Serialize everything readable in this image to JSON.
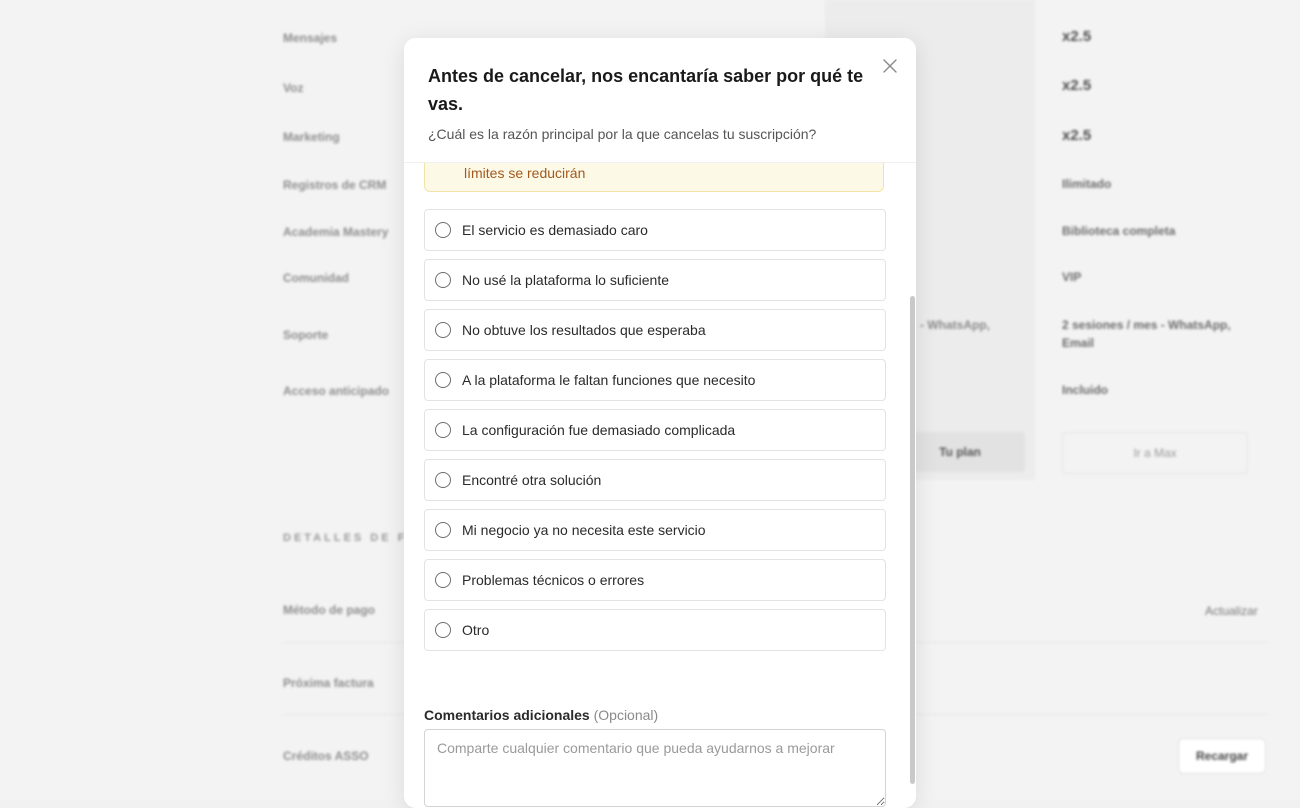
{
  "background": {
    "rows": [
      {
        "label": "Mensajes",
        "value": "x2.5"
      },
      {
        "label": "Voz",
        "value": "x2.5"
      },
      {
        "label": "Marketing",
        "value": "x2.5"
      },
      {
        "label": "Registros de CRM",
        "value": "Ilimitado"
      },
      {
        "label": "Academia Mastery",
        "value": "Biblioteca completa"
      },
      {
        "label": "Comunidad",
        "value": "VIP"
      },
      {
        "label": "Soporte",
        "value": "2 sesiones / mes - WhatsApp, Email"
      },
      {
        "label": "Acceso anticipado",
        "value": "Incluido"
      }
    ],
    "current_plan_support": "- WhatsApp,",
    "current_plan_button": "Tu plan",
    "go_to_max_button": "Ir a Max",
    "billing_section_title": "DETALLES DE F",
    "payment_method_label": "Método de pago",
    "update_link": "Actualizar",
    "next_invoice_label": "Próxima factura",
    "asso_credits_label": "Créditos ASSO",
    "recharge_button": "Recargar"
  },
  "modal": {
    "title": "Antes de cancelar, nos encantaría saber por qué te vas.",
    "subtitle": "¿Cuál es la razón principal por la que cancelas tu suscripción?",
    "warning_text": "límites se reducirán",
    "options": [
      "El servicio es demasiado caro",
      "No usé la plataforma lo suficiente",
      "No obtuve los resultados que esperaba",
      "A la plataforma le faltan funciones que necesito",
      "La configuración fue demasiado complicada",
      "Encontré otra solución",
      "Mi negocio ya no necesita este servicio",
      "Problemas técnicos o errores",
      "Otro"
    ],
    "comments_label": "Comentarios adicionales",
    "comments_optional": "(Opcional)",
    "comments_placeholder": "Comparte cualquier comentario que pueda ayudarnos a mejorar"
  },
  "colors": {
    "warning_bg": "#fdf9e7",
    "warning_border": "#f2e4a6",
    "warning_text": "#a25a1e"
  }
}
